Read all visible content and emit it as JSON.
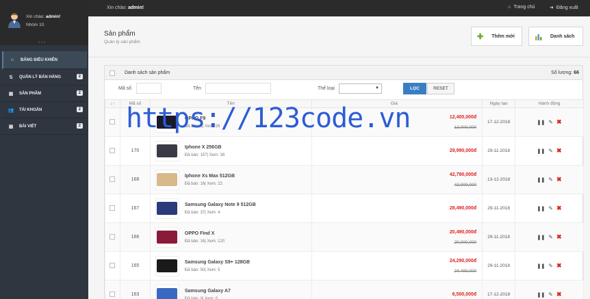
{
  "topbar": {
    "greeting_prefix": "Xin chào:",
    "greeting_user": "admin!",
    "home_label": "Trang chủ",
    "logout_label": "Đăng xuất"
  },
  "sidebar": {
    "user_greeting_prefix": "Xin chào:",
    "user_name": "admin!",
    "group": "Nhóm 10",
    "items": [
      {
        "label": "BẢNG ĐIỀU KHIỂN",
        "icon": "home-icon",
        "badge": ""
      },
      {
        "label": "QUẢN LÝ BÁN HÀNG",
        "icon": "sort-icon",
        "badge": "2"
      },
      {
        "label": "SẢN PHẨM",
        "icon": "grid-icon",
        "badge": "2"
      },
      {
        "label": "TÀI KHOẢN",
        "icon": "users-icon",
        "badge": "2"
      },
      {
        "label": "BÀI VIẾT",
        "icon": "grid-icon",
        "badge": "2"
      }
    ]
  },
  "page": {
    "title": "Sản phẩm",
    "subtitle": "Quản lý sản phẩm",
    "add_button": "Thêm mới",
    "list_button": "Danh sách"
  },
  "panel": {
    "title": "Danh sách sản phẩm",
    "count_label": "Số lượng:",
    "count": "66"
  },
  "filter": {
    "id_label": "Mã số",
    "name_label": "Tên",
    "category_label": "Thể loại",
    "filter_button": "LỌC",
    "reset_button": "RESET"
  },
  "table": {
    "headers": [
      "↓↑",
      "Mã số",
      "Tên",
      "Giá",
      "Ngày tạo",
      "Hành động"
    ],
    "rows": [
      {
        "id": "",
        "name": "OPPO F9",
        "stats": "Đã bán: 1| Xem: 26",
        "price": "12,400,000đ",
        "old_price": "13,000,000",
        "date": "17-12-2018",
        "img": "#1a1a2a"
      },
      {
        "id": "170",
        "name": "Iphone X 256GB",
        "stats": "Đã bán: 157| Xem: 38",
        "price": "29,990,000đ",
        "old_price": "",
        "date": "29-11-2018",
        "img": "#3a3a44"
      },
      {
        "id": "168",
        "name": "Iphone Xs Max 512GB",
        "stats": "Đã bán: 16| Xem: 22",
        "price": "42,790,000đ",
        "old_price": "42,000,000",
        "date": "13-12-2018",
        "img": "#d8b98a"
      },
      {
        "id": "167",
        "name": "Samsung Galaxy Note 9 512GB",
        "stats": "Đã bán: 37| Xem: 4",
        "price": "28,490,000đ",
        "old_price": "",
        "date": "29-11-2018",
        "img": "#2a3a7a"
      },
      {
        "id": "166",
        "name": "OPPO Find X",
        "stats": "Đã bán: 16| Xem: 120",
        "price": "20,490,000đ",
        "old_price": "20,000,000",
        "date": "29-11-2018",
        "img": "#8a1a3a"
      },
      {
        "id": "165",
        "name": "Samsung Galaxy S9+ 128GB",
        "stats": "Đã bán: 50| Xem: 5",
        "price": "24,290,000đ",
        "old_price": "24,490,000",
        "date": "29-11-2018",
        "img": "#1a1a1a"
      },
      {
        "id": "163",
        "name": "Samsung Galaxy A7",
        "stats": "Đã bán: 0| Xem: 0",
        "price": "6,500,000đ",
        "old_price": "",
        "date": "17-12-2018",
        "img": "#3a6ac0"
      }
    ]
  },
  "watermark": "https://123code.vn"
}
